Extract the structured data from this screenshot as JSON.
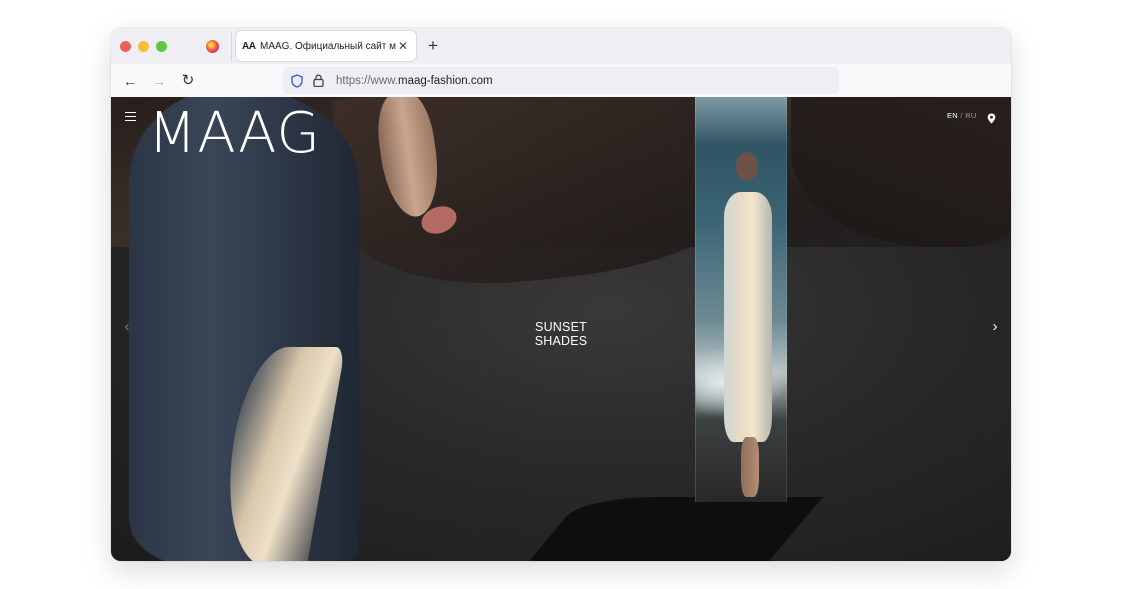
{
  "browser": {
    "tab": {
      "icon": "AA",
      "title": "MAAG. Официальный сайт маг",
      "close": "✕"
    },
    "new_tab": "+",
    "nav": {
      "back": "←",
      "forward": "→",
      "reload": "↻"
    },
    "url": {
      "scheme": "https://www.",
      "domain": "maag-fashion.com"
    },
    "icons": {
      "pinned_tab": "firefox-icon",
      "shield": "shield-icon",
      "lock": "lock-icon"
    }
  },
  "site": {
    "logo": "MAAG",
    "lang": {
      "active": "EN",
      "separator": "/",
      "inactive": "RU"
    },
    "slide_title": "SUNSET SHADES",
    "prev_arrow": "‹",
    "next_arrow": "›",
    "icons": {
      "menu": "hamburger-menu-icon",
      "location": "location-pin-icon"
    }
  },
  "colors": {
    "close": "#ef5f57",
    "minimize": "#f6bd3c",
    "maximize": "#5fc648",
    "shield": "#3d5bd6"
  }
}
